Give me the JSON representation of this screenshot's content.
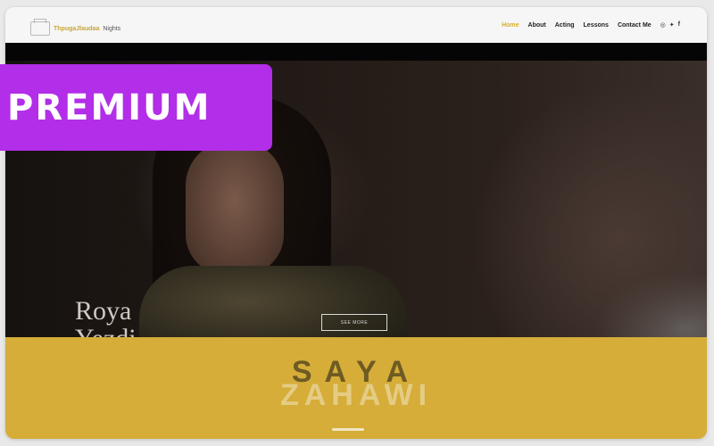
{
  "header": {
    "logo_text_a": "ThpugaJlaudaa",
    "logo_text_b": "Nights",
    "nav": [
      {
        "label": "Home",
        "active": true
      },
      {
        "label": "About",
        "active": false
      },
      {
        "label": "Acting",
        "active": false
      },
      {
        "label": "Lessons",
        "active": false
      },
      {
        "label": "Contact Me",
        "active": false
      }
    ],
    "social": [
      "◎",
      "✦",
      "f"
    ]
  },
  "hero": {
    "name": "Roya",
    "name_sub": "Yezdi",
    "button_label": "SEE MORE"
  },
  "band": {
    "title": "SAYA",
    "subtitle": "ZAHAWI"
  },
  "badge": {
    "label": "PREMIUM",
    "color": "#b22ee8"
  },
  "colors": {
    "accent": "#d5ad38",
    "nav_active": "#d8b02c"
  }
}
